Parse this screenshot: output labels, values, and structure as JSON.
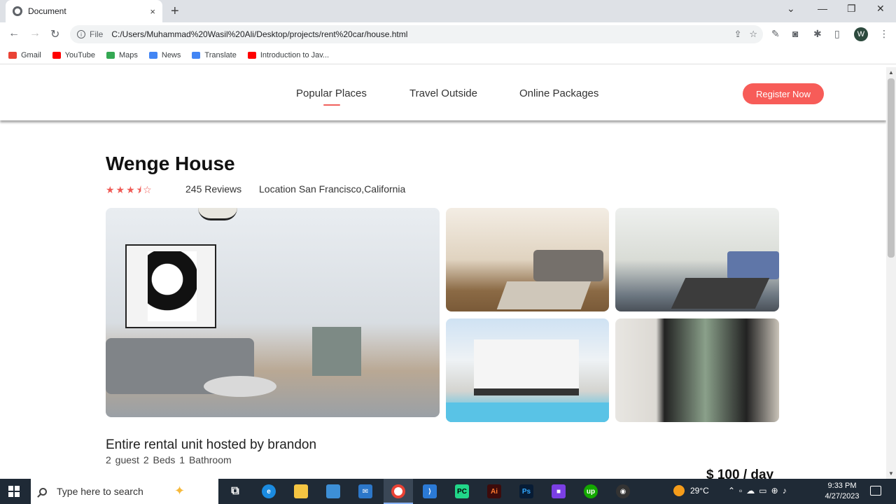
{
  "browser": {
    "tab_title": "Document",
    "close_glyph": "×",
    "new_tab_glyph": "+",
    "omnibox_info": "i",
    "omnibox_label": "File",
    "url": "C:/Users/Muhammad%20Wasil%20Ali/Desktop/projects/rent%20car/house.html",
    "avatar_letter": "W",
    "bookmarks": [
      {
        "label": "Gmail",
        "color": "#ea4335"
      },
      {
        "label": "YouTube",
        "color": "#ff0000"
      },
      {
        "label": "Maps",
        "color": "#34a853"
      },
      {
        "label": "News",
        "color": "#4285f4"
      },
      {
        "label": "Translate",
        "color": "#4285f4"
      },
      {
        "label": "Introduction to Jav...",
        "color": "#ff0000"
      }
    ]
  },
  "site": {
    "nav": {
      "items": [
        "Popular Places",
        "Travel Outside",
        "Online Packages"
      ],
      "active_index": 0,
      "register_label": "Register Now"
    },
    "house": {
      "title": "Wenge House",
      "rating": 3.5,
      "rating_max": 5,
      "stars_glyphs": "★★★⯨☆",
      "reviews": "245 Reviews",
      "location": "Location San Francisco,California"
    },
    "rental": {
      "title": "Entire rental unit hosted by brandon",
      "details": "2 guest   2 Beds   1 Bathroom",
      "price": "$ 100 / day"
    }
  },
  "taskbar": {
    "search_placeholder": "Type here to search",
    "temperature": "29°C",
    "time": "9:33 PM",
    "date": "4/27/2023"
  },
  "colors": {
    "accent": "#f75c58",
    "taskbar": "#1f2a36"
  }
}
